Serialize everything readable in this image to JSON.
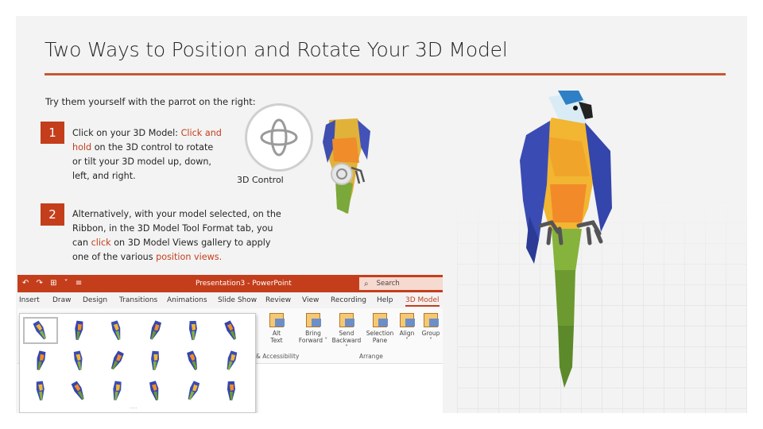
{
  "slide": {
    "title": "Two Ways to Position and Rotate Your 3D Model",
    "intro": "Try them yourself with the parrot on the right:",
    "accent_color": "#c43e1c",
    "steps": [
      {
        "number": "1",
        "text_a": "Click on your 3D Model: ",
        "highlight_a": "Click and hold",
        "text_b": " on the 3D control to rotate or tilt your 3D model up, down, left, and right."
      },
      {
        "number": "2",
        "text_a": "Alternatively, with your model selected, on the Ribbon, in the 3D Model Tool Format tab, you can ",
        "highlight_a": "click",
        "text_b": " on 3D Model Views gallery to apply one of the various ",
        "highlight_b": "position views."
      }
    ],
    "control_label": "3D Control",
    "control_icon": "rotate-3d-icon"
  },
  "ribbon": {
    "window_title": "Presentation3 - PowerPoint",
    "search_placeholder": "Search",
    "tabs": [
      "Insert",
      "Draw",
      "Design",
      "Transitions",
      "Animations",
      "Slide Show",
      "Review",
      "View",
      "Recording",
      "Help",
      "3D Model"
    ],
    "active_tab": "3D Model",
    "buttons": [
      {
        "line1": "Alt",
        "line2": "Text"
      },
      {
        "line1": "Bring",
        "line2": "Forward ˅"
      },
      {
        "line1": "Send",
        "line2": "Backward ˅"
      },
      {
        "line1": "Selection",
        "line2": "Pane"
      },
      {
        "line1": "Align",
        "line2": "˅"
      },
      {
        "line1": "Group",
        "line2": "˅"
      }
    ],
    "groups": [
      "& Accessibility",
      "Arrange"
    ],
    "gallery_count": 18
  }
}
